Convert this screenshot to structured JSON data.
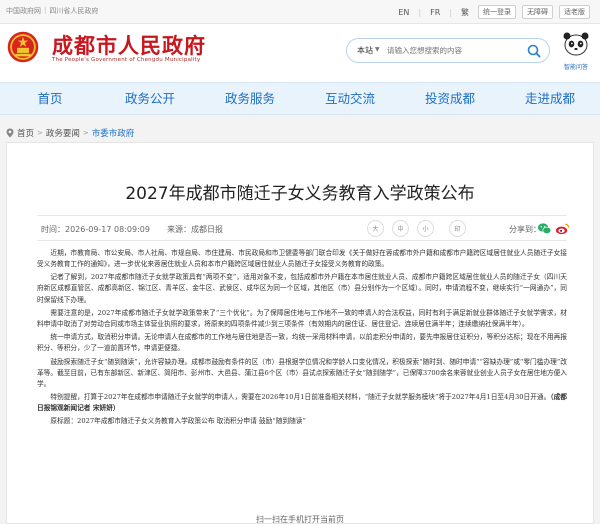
{
  "topbar": {
    "gov_link": "中国政府网",
    "province_link": "四川省人民政府",
    "separator": "|",
    "lang_en": "EN",
    "lang_fr": "FR",
    "lang_trad": "繁",
    "unified_login": "统一登录",
    "accessibility": "无障碍",
    "elder_mode": "适老版"
  },
  "header": {
    "site_title": "成都市人民政府",
    "site_subtitle": "The People's Government of Chengdu Municipality",
    "search_scope": "本站",
    "search_caret": "▼",
    "search_placeholder": "请输入您想搜索的内容",
    "panda_label": "智能问答"
  },
  "nav": {
    "items": [
      {
        "label": "首页"
      },
      {
        "label": "政务公开"
      },
      {
        "label": "政务服务"
      },
      {
        "label": "互动交流"
      },
      {
        "label": "投资成都"
      },
      {
        "label": "走进成都"
      }
    ]
  },
  "breadcrumb": {
    "home": "首页",
    "news": "政务要闻",
    "current": "市委市政府",
    "arrow": ">"
  },
  "article": {
    "title": "2027年成都市随迁子女义务教育入学政策公布",
    "time": "时间：2026-09-17 08:09:09",
    "source": "来源：成都日报",
    "font_large": "大",
    "font_medium": "中",
    "font_small": "小",
    "print": "印",
    "share_label": "分享到：",
    "paragraphs": [
      "近期，市教育局、市公安局、市人社局、市规自局、市住建局、市民政局和市卫健委等部门联合印发《关于做好在蓉成都市外户籍和成都市户籍跨区域居住就业人员随迁子女接受义务教育工作的通知》，进一步优化来蓉居住就业人员和本市户籍跨区域居住就业人员随迁子女接受义务教育的政策。",
      "记者了解到，2027年成都市随迁子女就学政策具有“两项不变”，适用对象不变，包括成都市外户籍在本市居住就业人员、成都市户籍跨区域居住就业人员的随迁子女（四川天府新区成都直管区、成都高新区、锦江区、青羊区、金牛区、武侯区、成华区为同一个区域，其他区（市）县分别作为一个区域）。同时，申请流程不变，继续实行“一网通办”，同时保留线下办理。",
      "需要注意的是，2027年成都市随迁子女就学政策带来了“三个优化”。为了保障居住地与工作地不一致的申请人的合法权益，同时有利于满足新就业群体随迁子女就学需求，材料申请中取消了对劳动合同或市场主体营业执照的要求，将原来的四项条件减少到三项条件（有效期内的居住证、居住登记、连续居住满半年；连续缴纳社保满半年）。",
      "统一申请方式，取消积分申请。无论申请人在成都市的工作地与居住地是否一致，均统一采用材料申请，以前走积分申请的，要先申报居住证积分，等积分达标；现在不用再报积分、等积分，少了一道前置环节，申请更便捷。",
      "鼓励探索随迁子女“随到随读”，允许容缺办理。成都市鼓励有条件的区（市）县根据学位情况和学龄人口变化情况，积极探索“随时到、随时申请”“容缺办理”或“零门槛办理”改革等。截至目前，已有东部新区、新津区、简阳市、彭州市、大邑县、蒲江县6个区（市）县试点探索随迁子女“随到随学”，已保障3700余名来蓉就业创业人员子女在居住地方便入学。",
      "特别提醒，打算于2027年在成都市申请随迁子女就学的申请人，需要在2026年10月1日前准备相关材料，“随迁子女就学服务模块”将于2027年4月1日至4月30日开通。",
      "原标题：2027年成都市随迁子女义务教育入学政策公布 取消积分申请 鼓励“随到随读”"
    ],
    "byline": "（成都日报锦观新闻记者 宋妍妍）",
    "qr_tip": "扫一扫在手机打开当前页"
  },
  "colors": {
    "brand_red": "#c8161d",
    "nav_blue": "#1d6fc4",
    "nav_bg": "#e9f3fc"
  }
}
